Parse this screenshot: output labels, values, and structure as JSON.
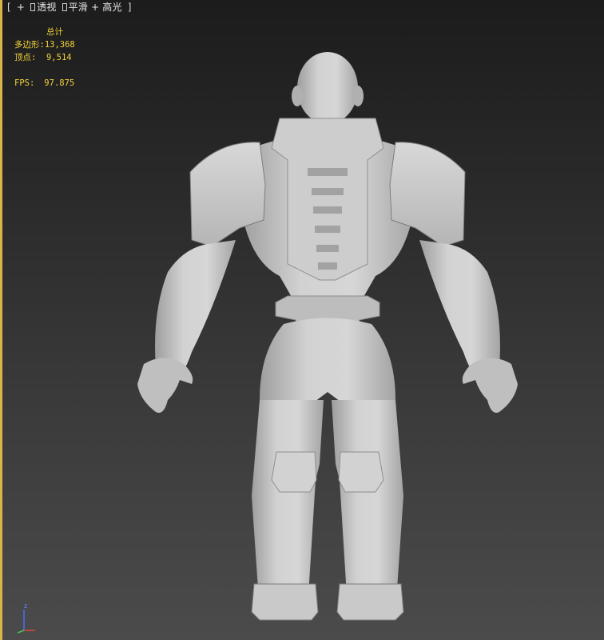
{
  "viewport": {
    "label": {
      "open_bracket": "[",
      "plus_menu": "+",
      "view_menu": "透视",
      "shading_menu": "平滑 + 高光",
      "close_bracket": "]"
    },
    "stats": {
      "total_label": "总计",
      "polygons_label": "多边形:",
      "polygons_value": "13,368",
      "vertices_label": "顶点:",
      "vertices_value": "9,514",
      "fps_label": "FPS:",
      "fps_value": "97.875"
    },
    "axis": {
      "z_label": "z"
    },
    "colors": {
      "active_border": "#d9b44a",
      "stats_text": "#f2d23a",
      "model_fill": "#c8c8c8",
      "axis_z": "#4a6cff",
      "axis_x": "#e04a3a"
    }
  }
}
